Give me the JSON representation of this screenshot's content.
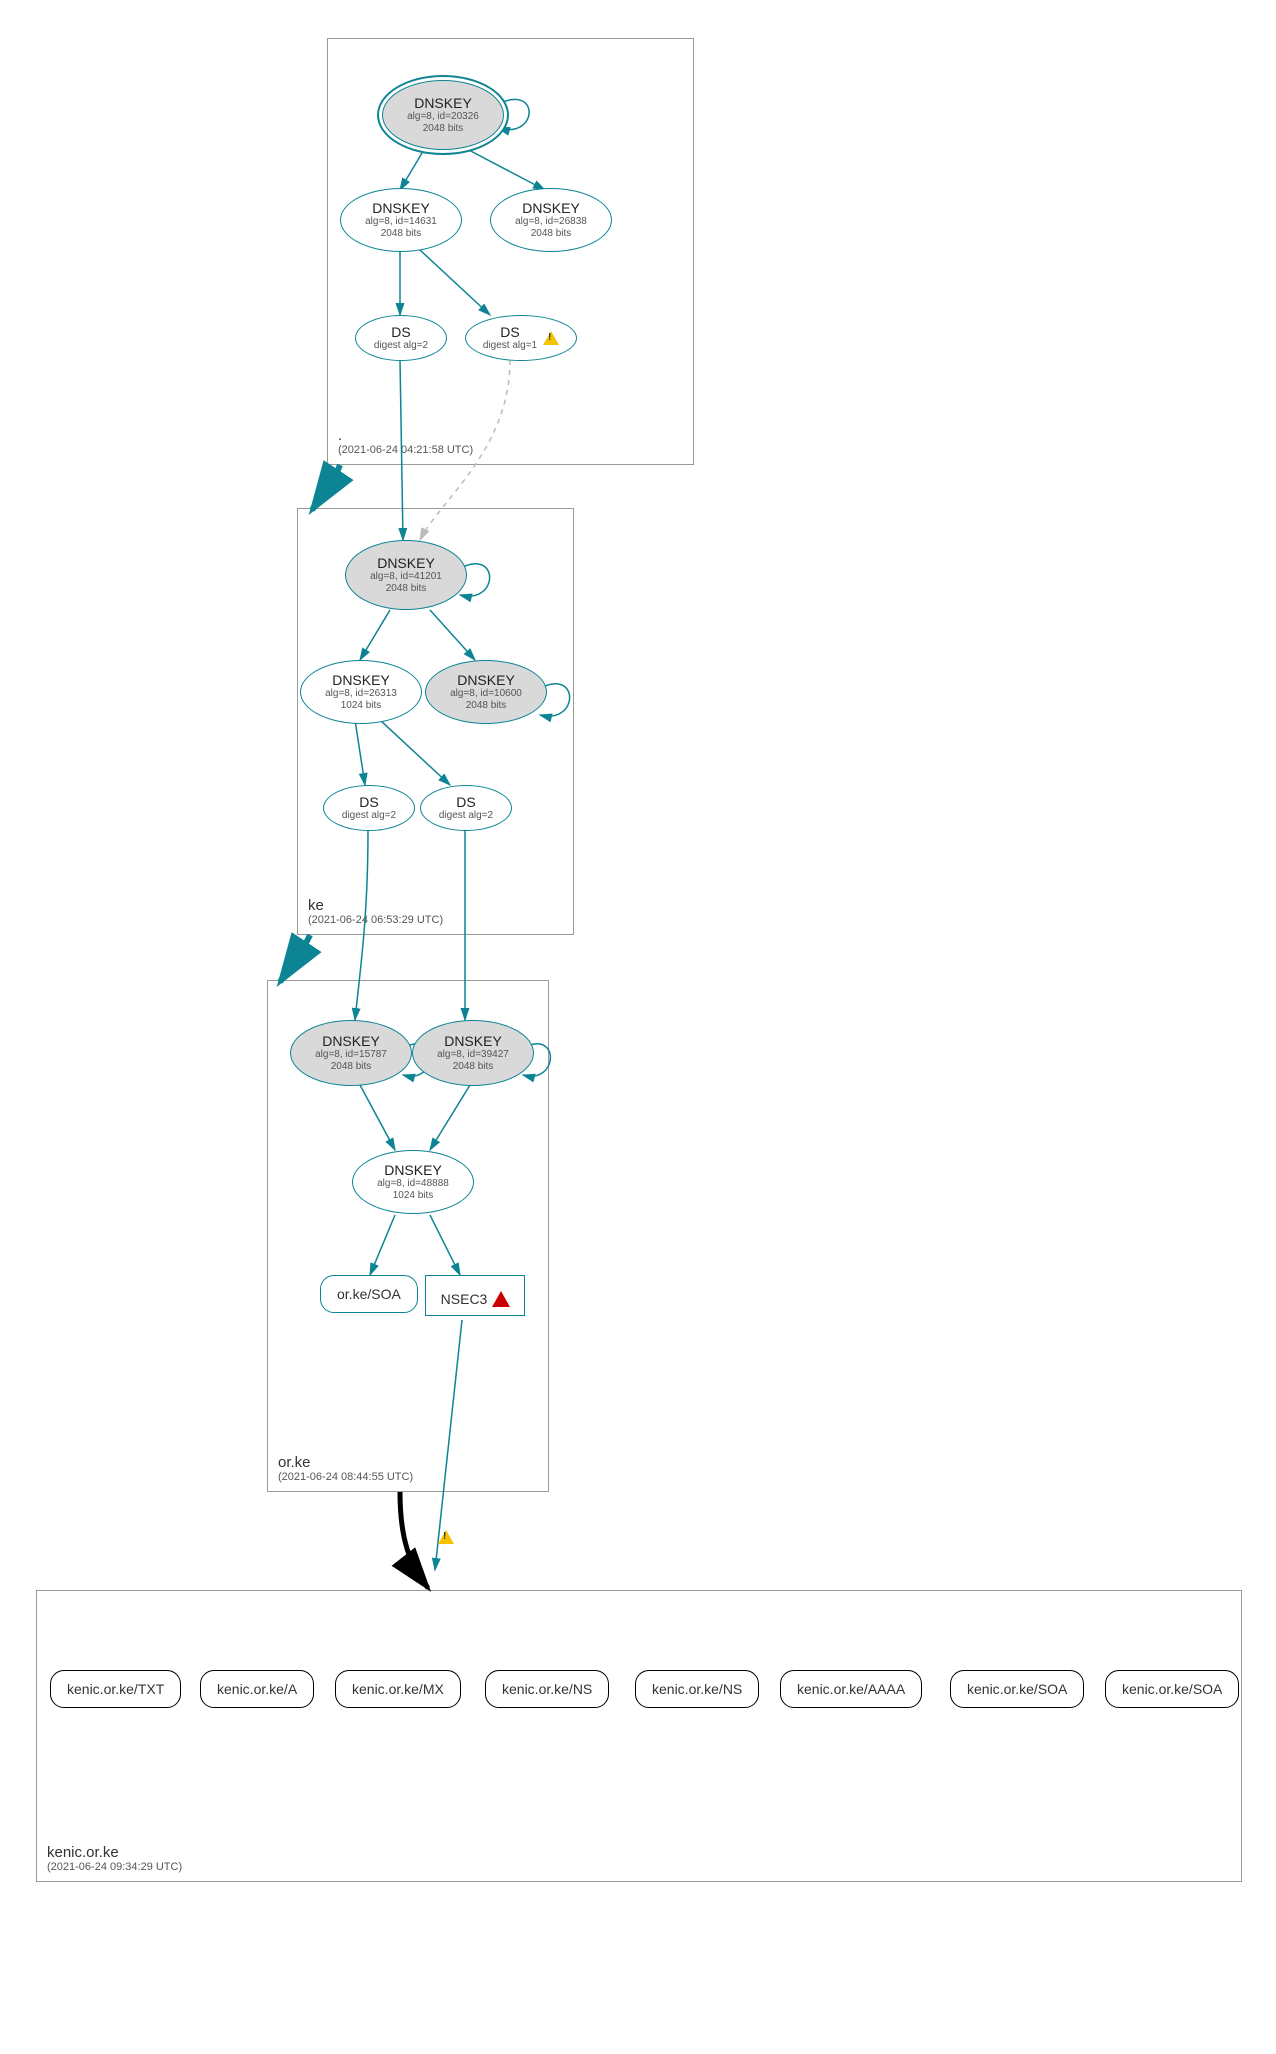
{
  "zones": {
    "root": {
      "name": ".",
      "timestamp": "(2021-06-24 04:21:58 UTC)"
    },
    "ke": {
      "name": "ke",
      "timestamp": "(2021-06-24 06:53:29 UTC)"
    },
    "orke": {
      "name": "or.ke",
      "timestamp": "(2021-06-24 08:44:55 UTC)"
    },
    "kenic": {
      "name": "kenic.or.ke",
      "timestamp": "(2021-06-24 09:34:29 UTC)"
    }
  },
  "nodes": {
    "root_ksk": {
      "title": "DNSKEY",
      "line1": "alg=8, id=20326",
      "line2": "2048 bits"
    },
    "root_zsk1": {
      "title": "DNSKEY",
      "line1": "alg=8, id=14631",
      "line2": "2048 bits"
    },
    "root_zsk2": {
      "title": "DNSKEY",
      "line1": "alg=8, id=26838",
      "line2": "2048 bits"
    },
    "root_ds1": {
      "title": "DS",
      "line1": "digest alg=2"
    },
    "root_ds2": {
      "title": "DS",
      "line1": "digest alg=1"
    },
    "ke_ksk": {
      "title": "DNSKEY",
      "line1": "alg=8, id=41201",
      "line2": "2048 bits"
    },
    "ke_zsk1": {
      "title": "DNSKEY",
      "line1": "alg=8, id=26313",
      "line2": "1024 bits"
    },
    "ke_zsk2": {
      "title": "DNSKEY",
      "line1": "alg=8, id=10600",
      "line2": "2048 bits"
    },
    "ke_ds1": {
      "title": "DS",
      "line1": "digest alg=2"
    },
    "ke_ds2": {
      "title": "DS",
      "line1": "digest alg=2"
    },
    "orke_ksk1": {
      "title": "DNSKEY",
      "line1": "alg=8, id=15787",
      "line2": "2048 bits"
    },
    "orke_ksk2": {
      "title": "DNSKEY",
      "line1": "alg=8, id=39427",
      "line2": "2048 bits"
    },
    "orke_zsk": {
      "title": "DNSKEY",
      "line1": "alg=8, id=48888",
      "line2": "1024 bits"
    },
    "orke_soa": "or.ke/SOA",
    "nsec3": "NSEC3",
    "rr": {
      "txt": "kenic.or.ke/TXT",
      "a": "kenic.or.ke/A",
      "mx": "kenic.or.ke/MX",
      "ns1": "kenic.or.ke/NS",
      "ns2": "kenic.or.ke/NS",
      "aaaa": "kenic.or.ke/AAAA",
      "soa1": "kenic.or.ke/SOA",
      "soa2": "kenic.or.ke/SOA"
    }
  }
}
